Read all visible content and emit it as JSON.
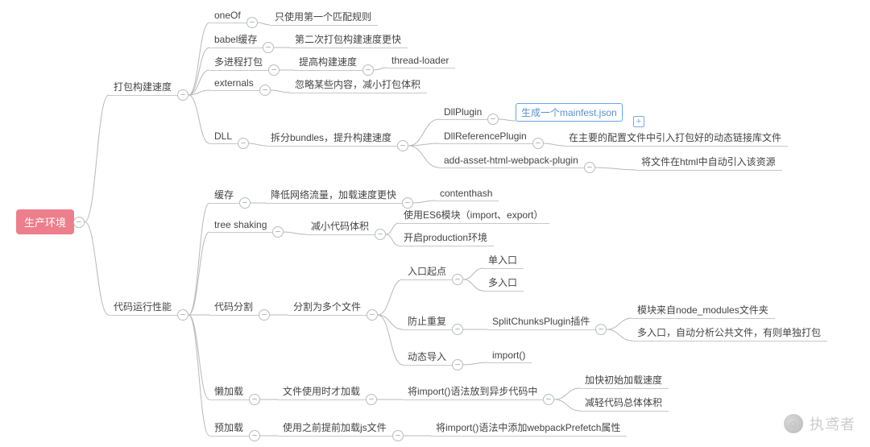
{
  "root": "生产环境",
  "l1": {
    "build": "打包构建速度",
    "perf": "代码运行性能"
  },
  "build": {
    "oneof": {
      "t": "oneOf",
      "d": "只使用第一个匹配规则"
    },
    "babel": {
      "t": "babel缓存",
      "d": "第二次打包构建速度更快"
    },
    "multi": {
      "t": "多进程打包",
      "d": "提高构建速度",
      "e": "thread-loader"
    },
    "ext": {
      "t": "externals",
      "d": "忽略某些内容，减小打包体积"
    },
    "dll": {
      "t": "DLL",
      "d": "拆分bundles，提升构建速度",
      "p1": {
        "t": "DllPlugin",
        "d": "生成一个mainfest.json"
      },
      "p2": {
        "t": "DllReferencePlugin",
        "d": "在主要的配置文件中引入打包好的动态链接库文件"
      },
      "p3": {
        "t": "add-asset-html-webpack-plugin",
        "d": "将文件在html中自动引入该资源"
      }
    }
  },
  "perf": {
    "cache": {
      "t": "缓存",
      "d": "降低网络流量，加载速度更快",
      "e": "contenthash"
    },
    "tree": {
      "t": "tree shaking",
      "d": "减小代码体积",
      "e1": "使用ES6模块（import、export）",
      "e2": "开启production环境"
    },
    "split": {
      "t": "代码分割",
      "d": "分割为多个文件",
      "entry": {
        "t": "入口起点",
        "e1": "单入口",
        "e2": "多入口"
      },
      "dup": {
        "t": "防止重复",
        "m": "SplitChunksPlugin插件",
        "e1": "模块来自node_modules文件夹",
        "e2": "多入口，自动分析公共文件，有则单独打包"
      },
      "dyn": {
        "t": "动态导入",
        "e": "import()"
      }
    },
    "lazy": {
      "t": "懒加载",
      "d": "文件使用时才加载",
      "m": "将import()语法放到异步代码中",
      "e1": "加快初始加载速度",
      "e2": "减轻代码总体体积"
    },
    "pre": {
      "t": "预加载",
      "d": "使用之前提前加载js文件",
      "m": "将import()语法中添加webpackPrefetch属性"
    }
  },
  "watermark": "执鸢者"
}
